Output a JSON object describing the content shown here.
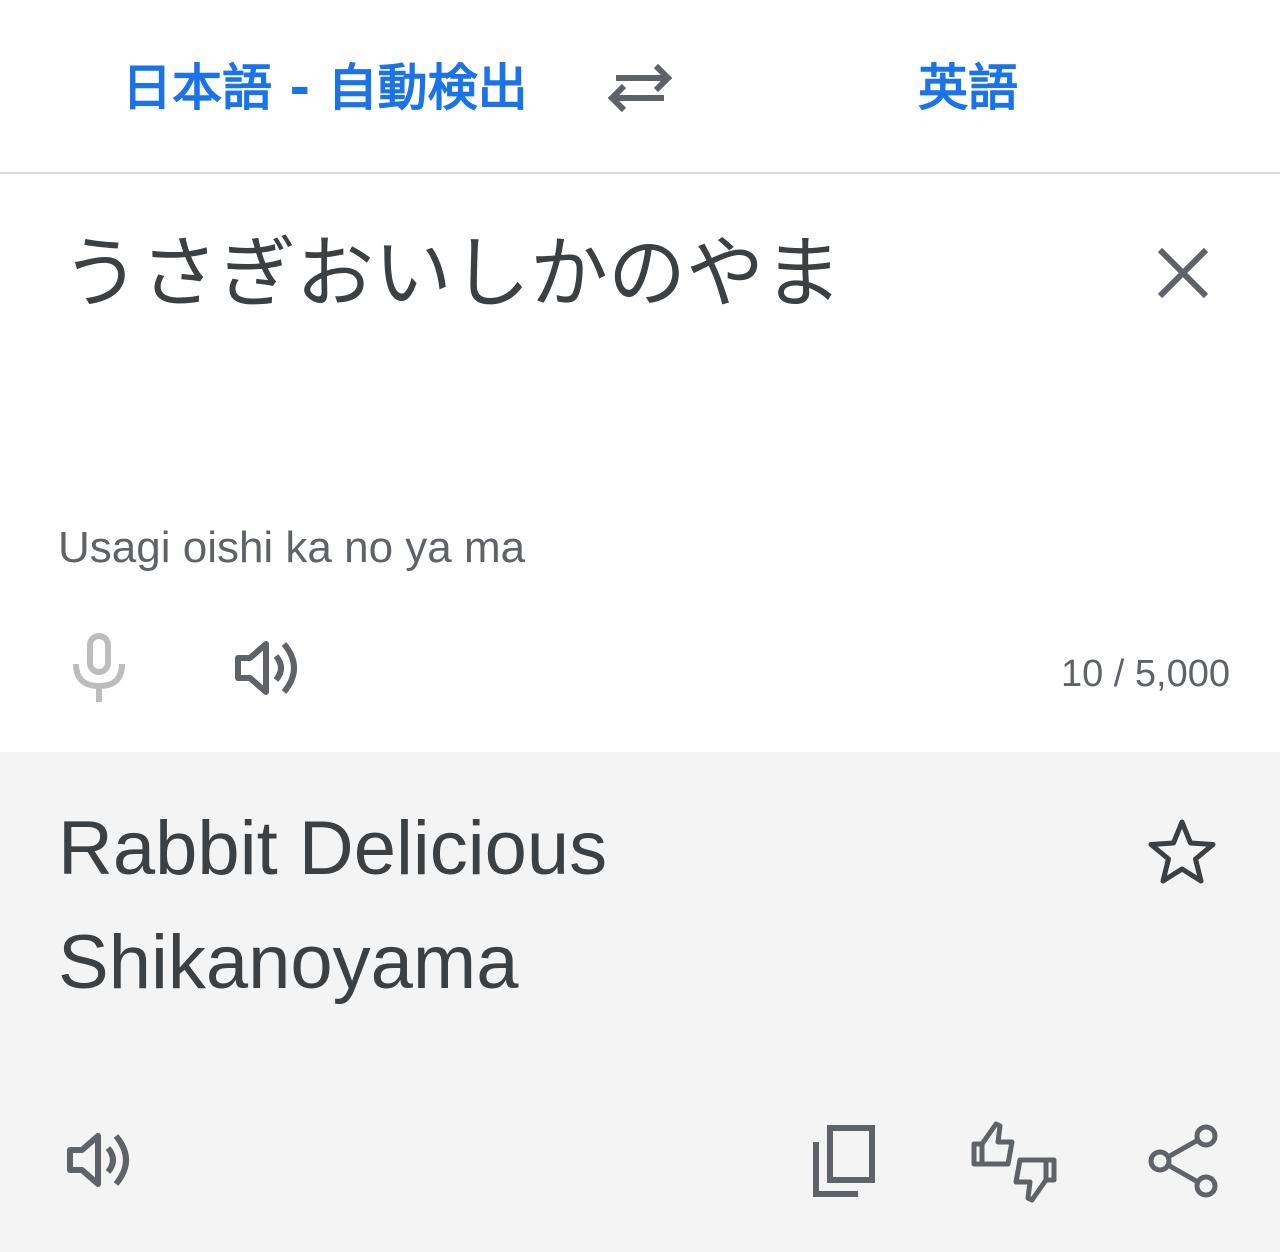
{
  "header": {
    "source_language": "日本語 - 自動検出",
    "target_language": "英語"
  },
  "source": {
    "text": "うさぎおいしかのやま",
    "romanization": "Usagi oishi ka no ya ma",
    "char_count": "10 / 5,000"
  },
  "result": {
    "translation": "Rabbit Delicious Shikanoyama"
  },
  "icons": {
    "swap": "swap-arrows-icon",
    "clear": "close-icon",
    "mic": "microphone-icon",
    "speaker": "speaker-icon",
    "star": "star-outline-icon",
    "copy": "copy-icon",
    "feedback": "feedback-thumbs-icon",
    "share": "share-icon"
  },
  "colors": {
    "accent": "#1a73e8",
    "text": "#3c4043",
    "secondary_text": "#5f6368",
    "result_background": "#f4f4f4"
  }
}
